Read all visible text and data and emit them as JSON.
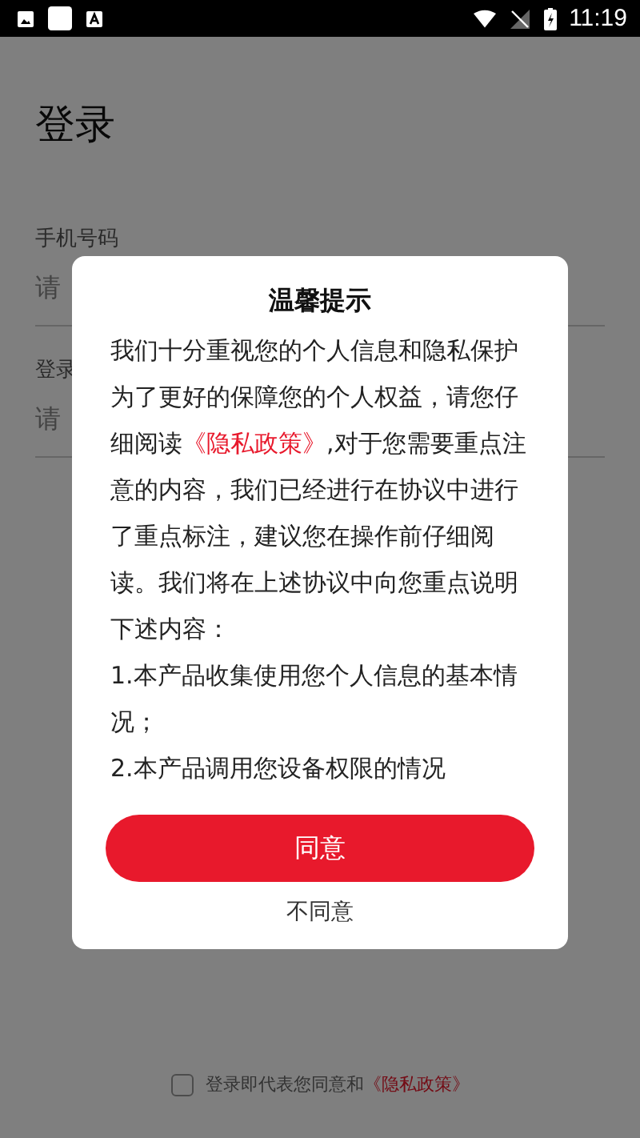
{
  "status_bar": {
    "time": "11:19"
  },
  "page": {
    "title": "登录",
    "phone_label": "手机号码",
    "phone_placeholder": "请",
    "code_label": "登录",
    "code_placeholder": "请"
  },
  "agreement": {
    "checked": false,
    "text": "登录即代表您同意和",
    "link": "《隐私政策》"
  },
  "dialog": {
    "title": "温馨提示",
    "before": "我们十分重视您的个人信息和隐私保护为了更好的保障您的个人权益，请您仔细阅读",
    "link": "《隐私政策》",
    "after": ",对于您需要重点注意的内容，我们已经进行在协议中进行了重点标注，建议您在操作前仔细阅读。我们将在上述协议中向您重点说明下述内容：",
    "items": [
      "1.本产品收集使用您个人信息的基本情况；",
      "2.本产品调用您设备权限的情况"
    ],
    "agree": "同意",
    "disagree": "不同意"
  }
}
